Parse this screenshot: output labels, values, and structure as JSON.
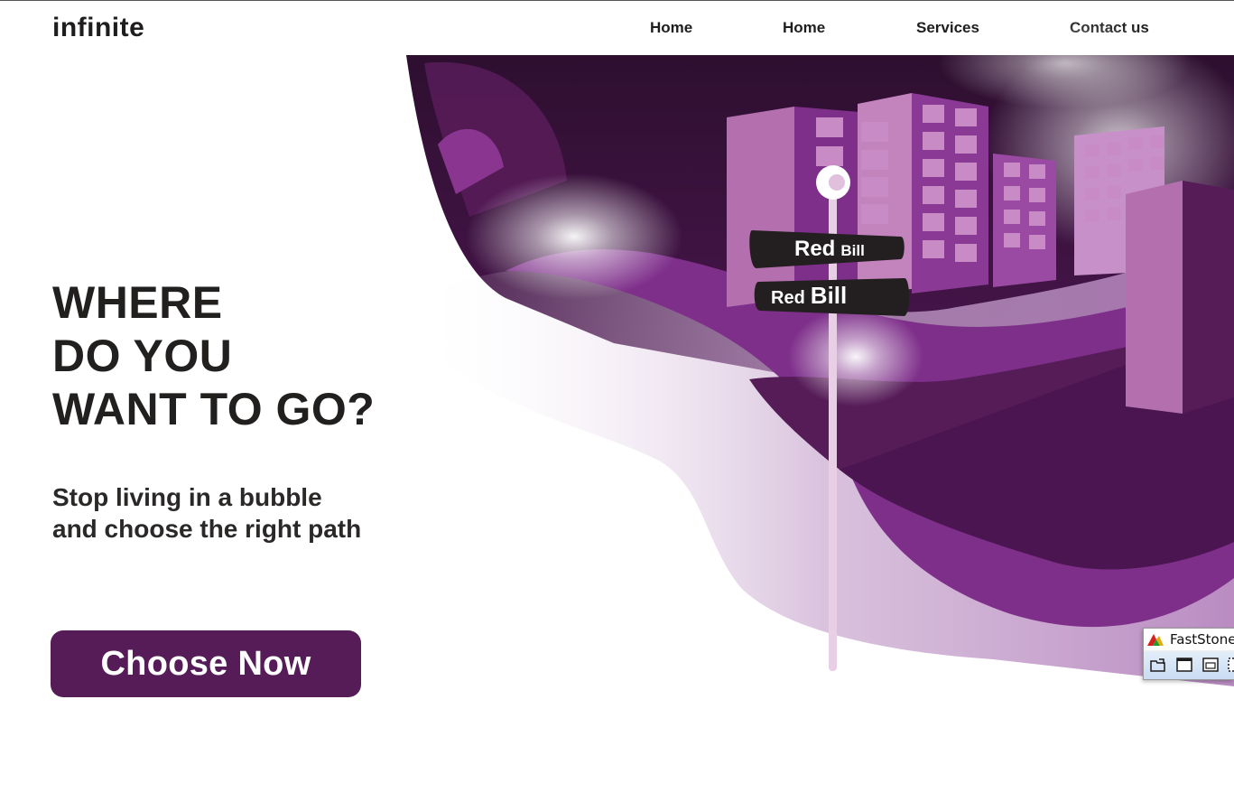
{
  "header": {
    "logo_text": "infinite",
    "nav": [
      {
        "label": "Home"
      },
      {
        "label": "Home"
      },
      {
        "label": "Services"
      },
      {
        "label": "Contact us"
      }
    ]
  },
  "hero": {
    "title_lines": [
      "WHERE",
      "DO YOU",
      "WANT TO GO?"
    ],
    "subtitle_lines": [
      "Stop living in a bubble",
      "and choose the right path"
    ],
    "cta_label": "Choose Now",
    "illustration": {
      "sign_top": {
        "word1": "Red",
        "word2": "Bill"
      },
      "sign_bottom": {
        "word1": "Red",
        "word2": "Bill"
      }
    }
  },
  "overlay_app": {
    "title": "FastStone",
    "toolbar_icons": [
      "open-folder-icon",
      "window-capture-icon",
      "object-capture-icon",
      "region-capture-icon"
    ]
  },
  "colors": {
    "accent": "#561c58",
    "purple_mid": "#7e2f8a",
    "purple_light": "#b46fae",
    "text_dark": "#221f1f"
  }
}
